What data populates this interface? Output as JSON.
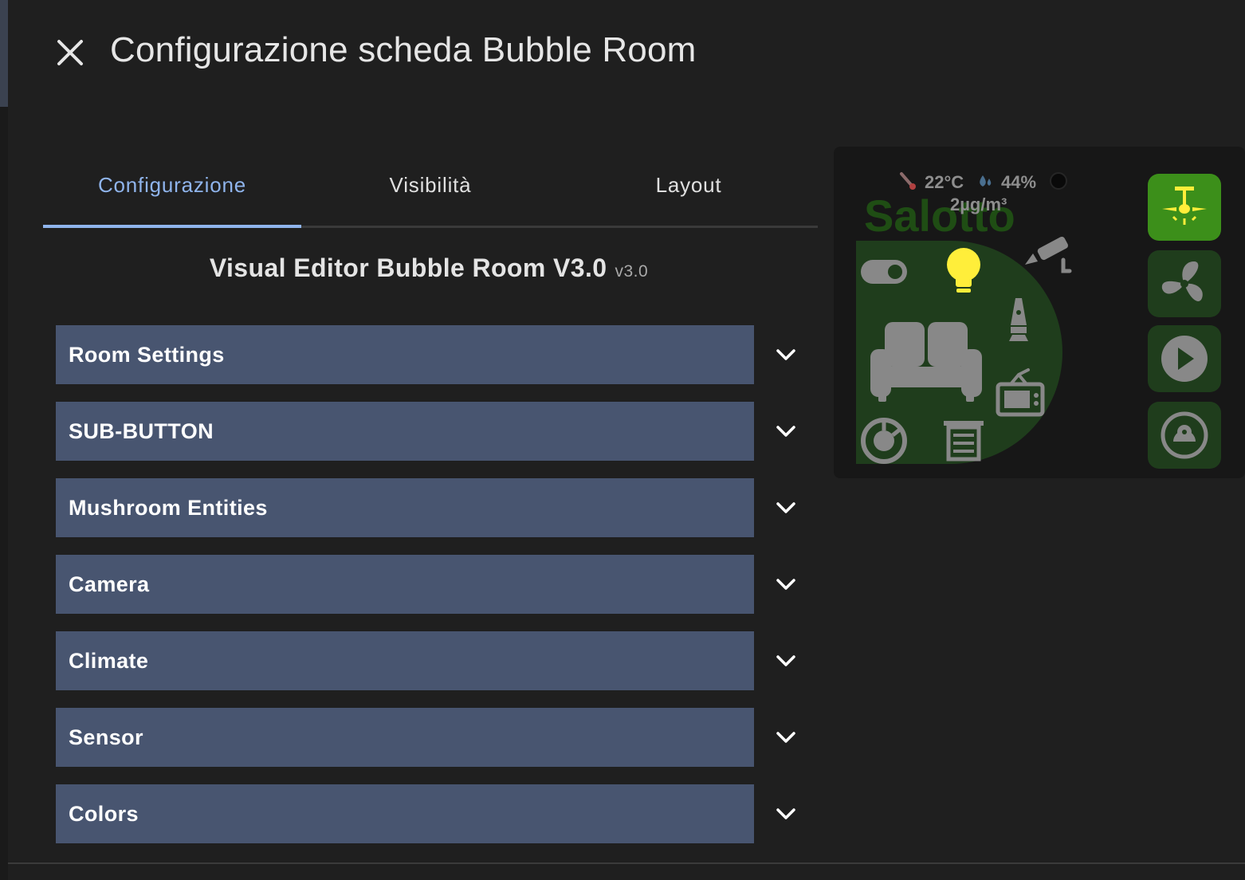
{
  "dialog": {
    "title": "Configurazione scheda Bubble Room"
  },
  "tabs": [
    {
      "label": "Configurazione",
      "active": true
    },
    {
      "label": "Visibilità",
      "active": false
    },
    {
      "label": "Layout",
      "active": false
    }
  ],
  "editor": {
    "heading": "Visual Editor Bubble Room V3.0",
    "version": "v3.0"
  },
  "sections": [
    {
      "label": "Room Settings"
    },
    {
      "label": "SUB-BUTTON"
    },
    {
      "label": "Mushroom Entities"
    },
    {
      "label": "Camera"
    },
    {
      "label": "Climate"
    },
    {
      "label": "Sensor"
    },
    {
      "label": "Colors"
    }
  ],
  "preview": {
    "room_name": "Salotto",
    "temperature": "22°C",
    "humidity": "44%",
    "air_quality": "2µg/m³",
    "icons": {
      "thermometer": "thermometer-icon",
      "humidity": "water-drop-icon",
      "status_dot": "status-dot-icon",
      "toggle": "toggle-icon",
      "light": "lightbulb-icon",
      "camera": "cctv-camera-icon",
      "lava_lamp": "lava-lamp-icon",
      "sofa": "sofa-icon",
      "tv": "television-icon",
      "vacuum": "robot-vacuum-icon",
      "blinds": "blinds-icon",
      "sub_buttons": [
        "ceiling-fan-light-icon",
        "fan-icon",
        "play-icon",
        "robot-vacuum-icon"
      ]
    },
    "colors": {
      "accent_green": "#3c8f1a",
      "room_bubble": "#1f3d1c",
      "room_name": "#1f4d14",
      "icon_grey": "#888888",
      "light_on": "#ffee3a"
    }
  }
}
